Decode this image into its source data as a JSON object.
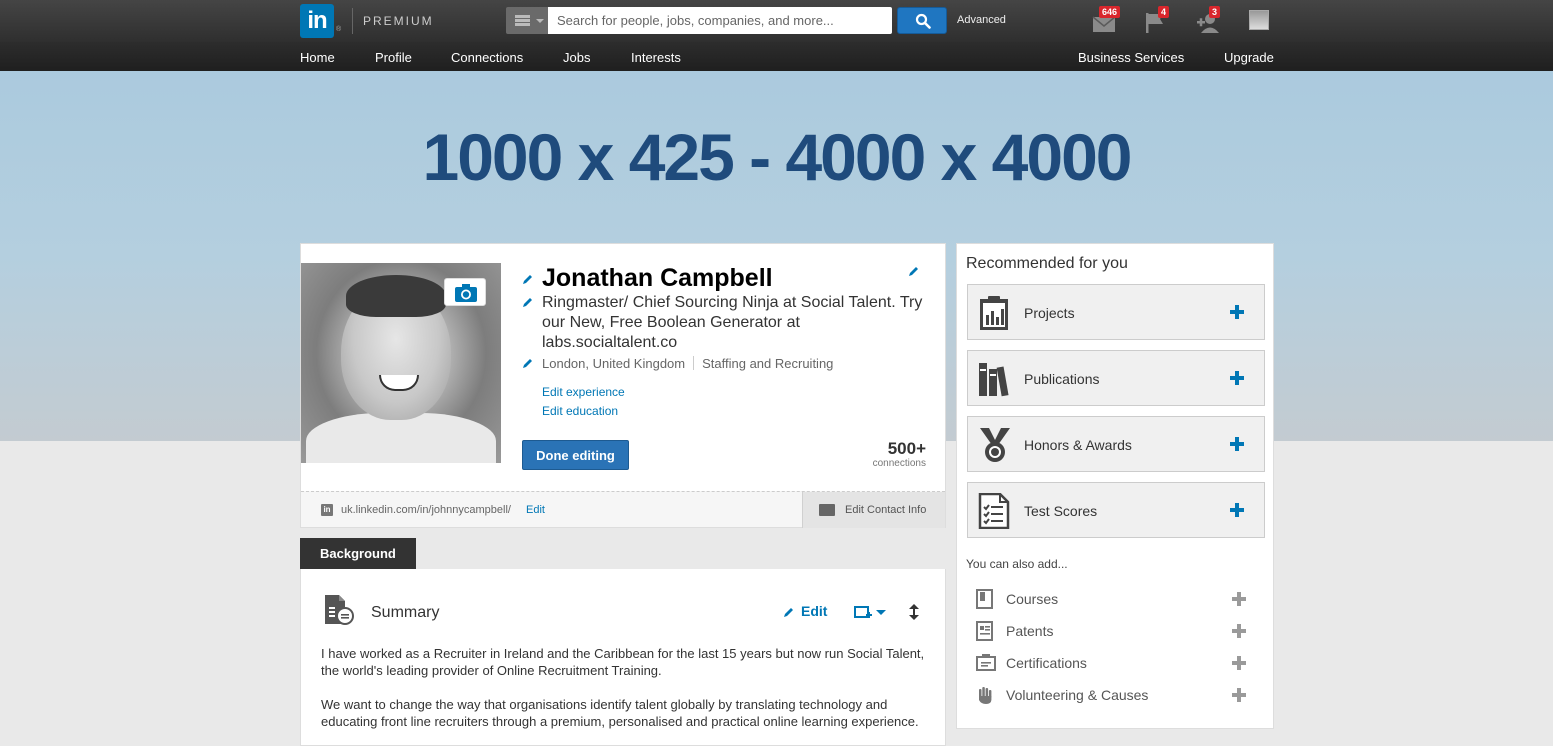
{
  "topbar": {
    "logo_text": "in",
    "logo_reg": "®",
    "premium_label": "PREMIUM",
    "search_placeholder": "Search for people, jobs, companies, and more...",
    "advanced_label": "Advanced",
    "messages_count": "646",
    "notifications_count": "4",
    "invitations_count": "3"
  },
  "nav": {
    "items": [
      "Home",
      "Profile",
      "Connections",
      "Jobs",
      "Interests"
    ],
    "right_items": [
      "Business Services",
      "Upgrade"
    ]
  },
  "banner": {
    "text": "1000 x 425 - 4000 x 4000"
  },
  "profile": {
    "name": "Jonathan Campbell",
    "headline": "Ringmaster/ Chief Sourcing Ninja at Social Talent. Try our New, Free Boolean Generator at labs.socialtalent.co",
    "location": "London, United Kingdom",
    "industry": "Staffing and Recruiting",
    "edit_experience": "Edit experience",
    "edit_education": "Edit education",
    "done_button": "Done editing",
    "connections_count": "500+",
    "connections_label": "connections",
    "url": "uk.linkedin.com/in/johnnycampbell/",
    "url_edit": "Edit",
    "edit_contact": "Edit Contact Info"
  },
  "background": {
    "tab_label": "Background",
    "summary_title": "Summary",
    "edit_label": "Edit",
    "paragraphs": [
      "I have worked as a Recruiter in Ireland and the Caribbean for the last 15 years but now run Social Talent, the world's leading provider of Online Recruitment Training.",
      "We want to change the way that organisations identify talent globally by translating technology and educating front line recruiters through a premium, personalised and practical online learning experience."
    ]
  },
  "recommended": {
    "title": "Recommended for you",
    "items": [
      "Projects",
      "Publications",
      "Honors & Awards",
      "Test Scores"
    ],
    "also_label": "You can also add...",
    "also_items": [
      "Courses",
      "Patents",
      "Certifications",
      "Volunteering & Causes"
    ]
  },
  "colors": {
    "brand": "#0077b5",
    "banner_text": "#1f4b7c",
    "badge": "#d9262c"
  }
}
